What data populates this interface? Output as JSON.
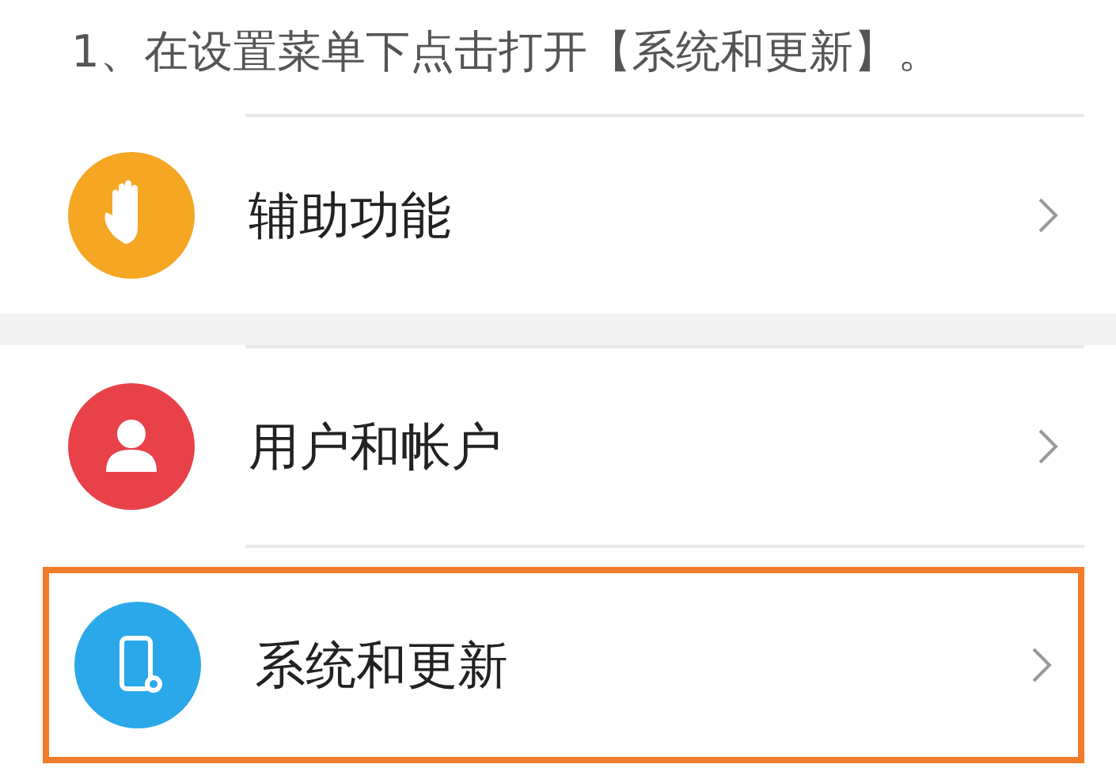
{
  "caption": "1、在设置菜单下点击打开【系统和更新】。",
  "groups": [
    {
      "items": [
        {
          "label": "辅助功能",
          "kind": "hand",
          "color": "#f5a623",
          "highlighted": false
        }
      ]
    },
    {
      "items": [
        {
          "label": "用户和帐户",
          "kind": "person",
          "color": "#e8414a",
          "highlighted": false
        },
        {
          "label": "系统和更新",
          "kind": "phone",
          "color": "#2aa8ea",
          "highlighted": true
        }
      ]
    }
  ]
}
